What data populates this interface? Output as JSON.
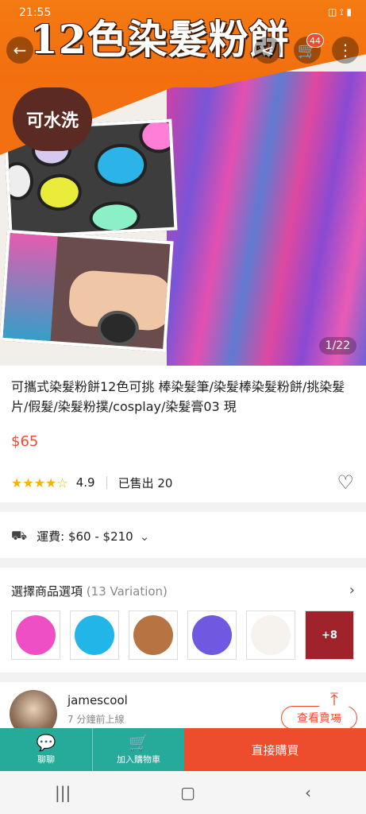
{
  "status_bar": {
    "time": "21:55",
    "icons": "◫  ⟟ ▮"
  },
  "banner": {
    "title": "12色染髮粉餅"
  },
  "header": {
    "cart_badge": "44",
    "back_icon": "back-arrow-icon",
    "share_icon": "share-icon",
    "cart_icon": "cart-icon",
    "more_icon": "more-vertical-icon"
  },
  "hero": {
    "washable_label": "可水洗",
    "page_indicator": "1/22"
  },
  "product": {
    "title": "可攜式染髮粉餅12色可挑 棒染髮筆/染髮棒染髮粉餅/挑染髮片/假髮/染髮粉撲/cosplay/染髮膏03 現",
    "price": "$65",
    "rating": "4.9",
    "sold": "已售出 20"
  },
  "shipping": {
    "label": "運費: $60 - $210"
  },
  "variations": {
    "label": "選擇商品選項",
    "count": "(13 Variation)",
    "more_label": "+8",
    "swatch_colors": [
      "#ee4fc4",
      "#22b5e8",
      "#b77442",
      "#7158e0",
      "#f6f2ee"
    ]
  },
  "seller": {
    "name": "jamescool",
    "status": "7 分鐘前上線",
    "shop_button": "查看賣場"
  },
  "action_bar": {
    "chat_label": "聊聊",
    "add_cart_label": "加入購物車",
    "buy_label": "直接購買"
  },
  "colors": {
    "accent": "#ee4d2d",
    "teal": "#26aa99",
    "banner_orange": "#f47a12"
  }
}
